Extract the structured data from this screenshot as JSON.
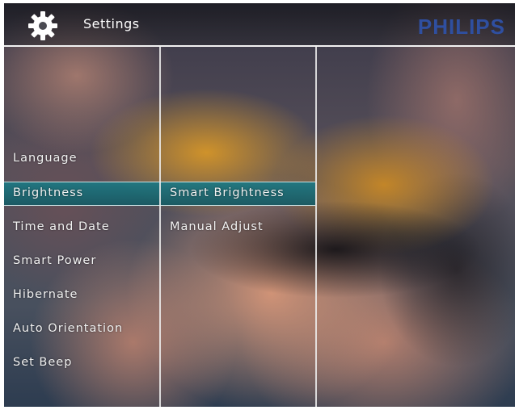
{
  "header": {
    "icon": "gear-icon",
    "title": "Settings",
    "brand": "PHILIPS"
  },
  "menu": {
    "items": [
      "Language",
      "Brightness",
      "Time and Date",
      "Smart Power",
      "Hibernate",
      "Auto Orientation",
      "Set Beep"
    ],
    "selected": "Brightness"
  },
  "submenu": {
    "items": [
      "Smart Brightness",
      "Manual Adjust"
    ],
    "selected": "Smart Brightness"
  },
  "colors": {
    "highlight": "#1e7882",
    "brand": "#2f4fa0"
  }
}
